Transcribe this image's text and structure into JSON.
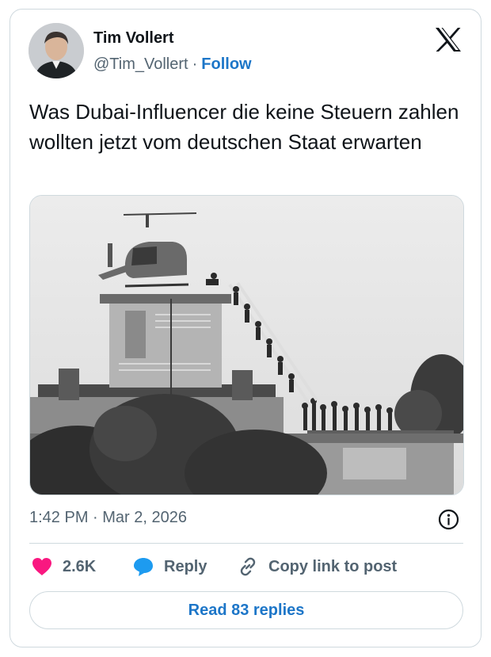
{
  "author": {
    "name": "Tim Vollert",
    "handle": "@Tim_Vollert",
    "separator": "·",
    "follow_label": "Follow"
  },
  "tweet": {
    "text": "Was Dubai-Influencer die keine Steuern zahlen wollten jetzt vom deutschen Staat erwarten",
    "timestamp": "1:42 PM · Mar 2, 2026"
  },
  "media": {
    "kind": "black-and-white photo"
  },
  "actions": {
    "like_count": "2.6K",
    "reply_label": "Reply",
    "copy_link_label": "Copy link to post"
  },
  "footer": {
    "read_replies_label": "Read 83 replies"
  },
  "colors": {
    "follow_blue": "#1d76c8",
    "like_pink": "#f91880",
    "reply_blue": "#1d9bf0",
    "text_dark": "#0f1419",
    "text_gray": "#536471",
    "border": "#cfd9de"
  },
  "icons": {
    "logo": "x-logo-icon",
    "info": "info-icon",
    "like": "heart-icon",
    "reply": "speech-bubble-icon",
    "copy_link": "link-icon"
  }
}
